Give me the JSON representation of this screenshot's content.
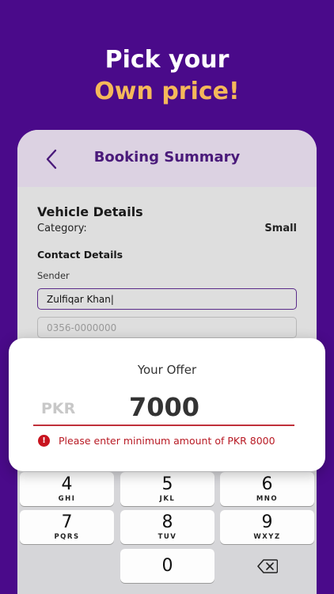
{
  "headline": {
    "line1": "Pick your",
    "line2": "Own price!"
  },
  "appbar": {
    "title": "Booking Summary",
    "back_icon": "chevron-left-icon"
  },
  "vehicle": {
    "title": "Vehicle Details",
    "category_label": "Category:",
    "category_value": "Small"
  },
  "contact": {
    "title": "Contact Details",
    "sender_label": "Sender",
    "name_value": "Zulfiqar Khan|",
    "phone_placeholder": "0356-0000000"
  },
  "offer": {
    "title": "Your Offer",
    "currency": "PKR",
    "amount": "7000",
    "error": "Please enter minimum amount of PKR 8000",
    "error_icon": "exclamation-circle-icon"
  },
  "keypad": {
    "keys": [
      {
        "num": "4",
        "letters": "GHI"
      },
      {
        "num": "5",
        "letters": "JKL"
      },
      {
        "num": "6",
        "letters": "MNO"
      },
      {
        "num": "7",
        "letters": "PQRS"
      },
      {
        "num": "8",
        "letters": "TUV"
      },
      {
        "num": "9",
        "letters": "WXYZ"
      },
      {
        "num": "0",
        "letters": ""
      }
    ],
    "delete_icon": "backspace-icon"
  },
  "colors": {
    "background": "#4a0a8a",
    "accent": "#f5b85a",
    "title": "#4a1a7a",
    "error": "#c8141f"
  }
}
